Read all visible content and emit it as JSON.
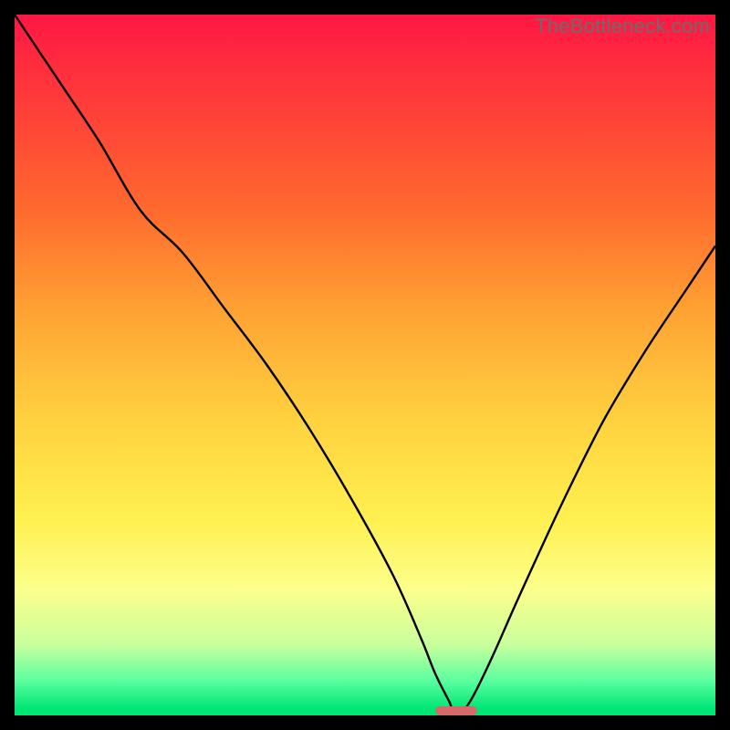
{
  "watermark": "TheBottleneck.com",
  "chart_data": {
    "type": "line",
    "title": "",
    "xlabel": "",
    "ylabel": "",
    "xlim": [
      0,
      100
    ],
    "ylim": [
      0,
      100
    ],
    "series": [
      {
        "name": "bottleneck-curve",
        "x": [
          0,
          6,
          12,
          18,
          24,
          30,
          36,
          42,
          48,
          54,
          58,
          60,
          62,
          63,
          65,
          68,
          72,
          78,
          84,
          90,
          96,
          100
        ],
        "values": [
          100,
          91,
          82,
          72,
          66,
          58,
          50,
          41,
          31,
          20,
          11,
          6,
          2,
          0,
          2,
          8,
          17,
          30,
          42,
          52,
          61,
          67
        ]
      }
    ],
    "marker": {
      "x_start": 60,
      "x_end": 66,
      "y": 0
    },
    "gradient_stops": [
      {
        "pct": 0,
        "color": "#ff1744"
      },
      {
        "pct": 12,
        "color": "#ff3a3a"
      },
      {
        "pct": 28,
        "color": "#ff6a2e"
      },
      {
        "pct": 42,
        "color": "#ffa133"
      },
      {
        "pct": 58,
        "color": "#ffd23f"
      },
      {
        "pct": 72,
        "color": "#fff050"
      },
      {
        "pct": 82,
        "color": "#fdff8c"
      },
      {
        "pct": 90,
        "color": "#c8ff9c"
      },
      {
        "pct": 95,
        "color": "#5cffa0"
      },
      {
        "pct": 99,
        "color": "#00e676"
      },
      {
        "pct": 100,
        "color": "#00e676"
      }
    ]
  }
}
